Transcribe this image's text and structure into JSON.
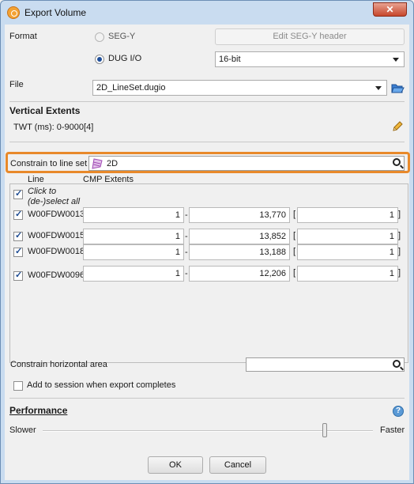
{
  "window": {
    "title": "Export Volume",
    "close_glyph": "✕"
  },
  "format": {
    "label": "Format",
    "options": [
      {
        "label": "SEG-Y",
        "selected": false,
        "enabled": false
      },
      {
        "label": "DUG I/O",
        "selected": true,
        "enabled": true
      }
    ],
    "edit_segy_header_label": "Edit SEG-Y header",
    "bit_depth": "16-bit"
  },
  "file": {
    "label": "File",
    "value": "2D_LineSet.dugio"
  },
  "vertical_extents": {
    "title": "Vertical Extents",
    "twt_text": "TWT (ms): 0-9000[4]"
  },
  "constrain": {
    "label": "Constrain to line set",
    "value": "2D"
  },
  "lines": {
    "col_line": "Line",
    "col_cmp": "CMP Extents",
    "select_all": "Click to (de-)select all",
    "rows": [
      {
        "name": "W00FDW0013",
        "checked": true,
        "from": "1",
        "to": "13,770",
        "step": "1"
      },
      {
        "name": "W00FDW0015",
        "checked": true,
        "from": "1",
        "to": "13,852",
        "step": "1"
      },
      {
        "name": "W00FDW0018",
        "checked": true,
        "from": "1",
        "to": "13,188",
        "step": "1"
      },
      {
        "name": "W00FDW0096",
        "checked": true,
        "from": "1",
        "to": "12,206",
        "step": "1"
      }
    ],
    "dash": "-",
    "open_bracket": "[",
    "close_bracket": "]"
  },
  "horizontal_area": {
    "label": "Constrain horizontal area"
  },
  "add_to_session": {
    "label": "Add to session when export completes",
    "checked": false
  },
  "performance": {
    "title": "Performance",
    "help": "?",
    "slower": "Slower",
    "faster": "Faster",
    "level": 0.86
  },
  "buttons": {
    "ok": "OK",
    "cancel": "Cancel"
  },
  "colors": {
    "highlight": "#e8892a",
    "accent": "#1f4f9a"
  },
  "icons": [
    "app-icon",
    "close-icon",
    "folder-open-icon",
    "pencil-icon",
    "line-set-icon",
    "search-icon",
    "help-icon",
    "dropdown-arrow-icon"
  ]
}
